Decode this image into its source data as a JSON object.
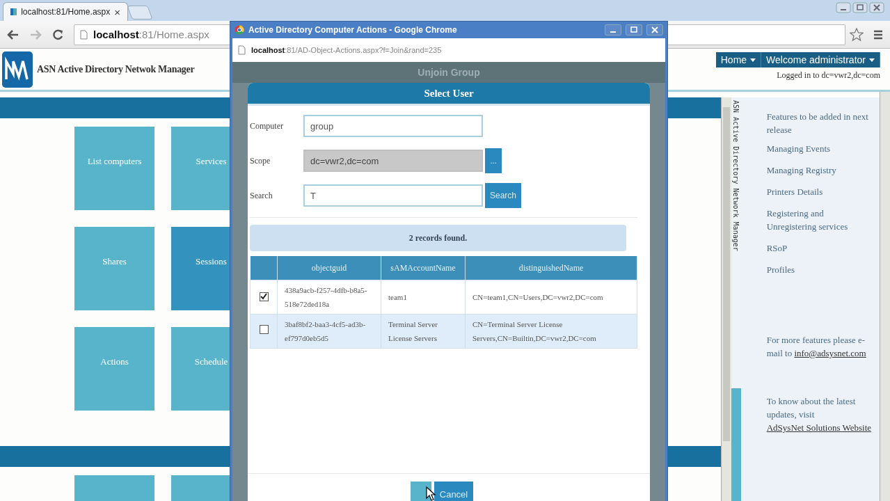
{
  "browser": {
    "tab_title": "localhost:81/Home.aspx",
    "tab_close": "×",
    "address_host": "localhost",
    "address_path": ":81/Home.aspx"
  },
  "page": {
    "app_title": "ASN Active Directory Netwok Manager",
    "nav": [
      {
        "label": "Home"
      },
      {
        "label": "Welcome administrator"
      }
    ],
    "logged_in": "Logged in to dc=vwr2,dc=com",
    "tiles": [
      {
        "label": "List computers",
        "selected": false
      },
      {
        "label": "Services",
        "selected": false
      },
      {
        "label": "Shares",
        "selected": false
      },
      {
        "label": "Sessions",
        "selected": true
      },
      {
        "label": "Actions",
        "selected": false
      },
      {
        "label": "Schedule",
        "selected": false
      }
    ],
    "side_banner": "ASN Active Directory Network Manager",
    "features_title": "Features to be added in next release",
    "features": [
      "Managing Events",
      "Managing Registry",
      "Printers Details",
      "Registering and Unregistering services",
      "RSoP",
      "Profiles"
    ],
    "contact_text": "For more features please e-mail to",
    "contact_link": "info@adsysnet.com",
    "updates_text": "To know about the latest updates, visit",
    "updates_link": "AdSysNet Solutions Website"
  },
  "popup": {
    "title": "Active Directory Computer Actions - Google Chrome",
    "address_host": "localhost",
    "address_path": ":81/AD-Object-Actions.aspx?f=Join&rand=235",
    "page_heading": "Unjoin Group",
    "dialog": {
      "title": "Select User",
      "fields": [
        {
          "label": "Computer",
          "value": "group",
          "kind": "text"
        },
        {
          "label": "Scope",
          "value": "dc=vwr2,dc=com",
          "kind": "readonly",
          "button": "..."
        },
        {
          "label": "Search",
          "value": "T",
          "kind": "text",
          "button": "Search"
        }
      ],
      "status": "2 records found.",
      "columns": [
        "objectguid",
        "sAMAccountName",
        "distinguishedName"
      ],
      "rows": [
        {
          "checked": true,
          "cells": [
            "438a9acb-f257-4dfb-b8a5-518e72ded18a",
            "team1",
            "CN=team1,CN=Users,DC=vwr2,DC=com"
          ]
        },
        {
          "checked": false,
          "cells": [
            "3baf8bf2-baa3-4cf5-ad3b-ef797d0eb5d5",
            "Terminal Server License Servers",
            "CN=Terminal Server License Servers,CN=Builtin,DC=vwr2,DC=com"
          ]
        }
      ],
      "buttons": [
        "Cancel"
      ]
    }
  }
}
